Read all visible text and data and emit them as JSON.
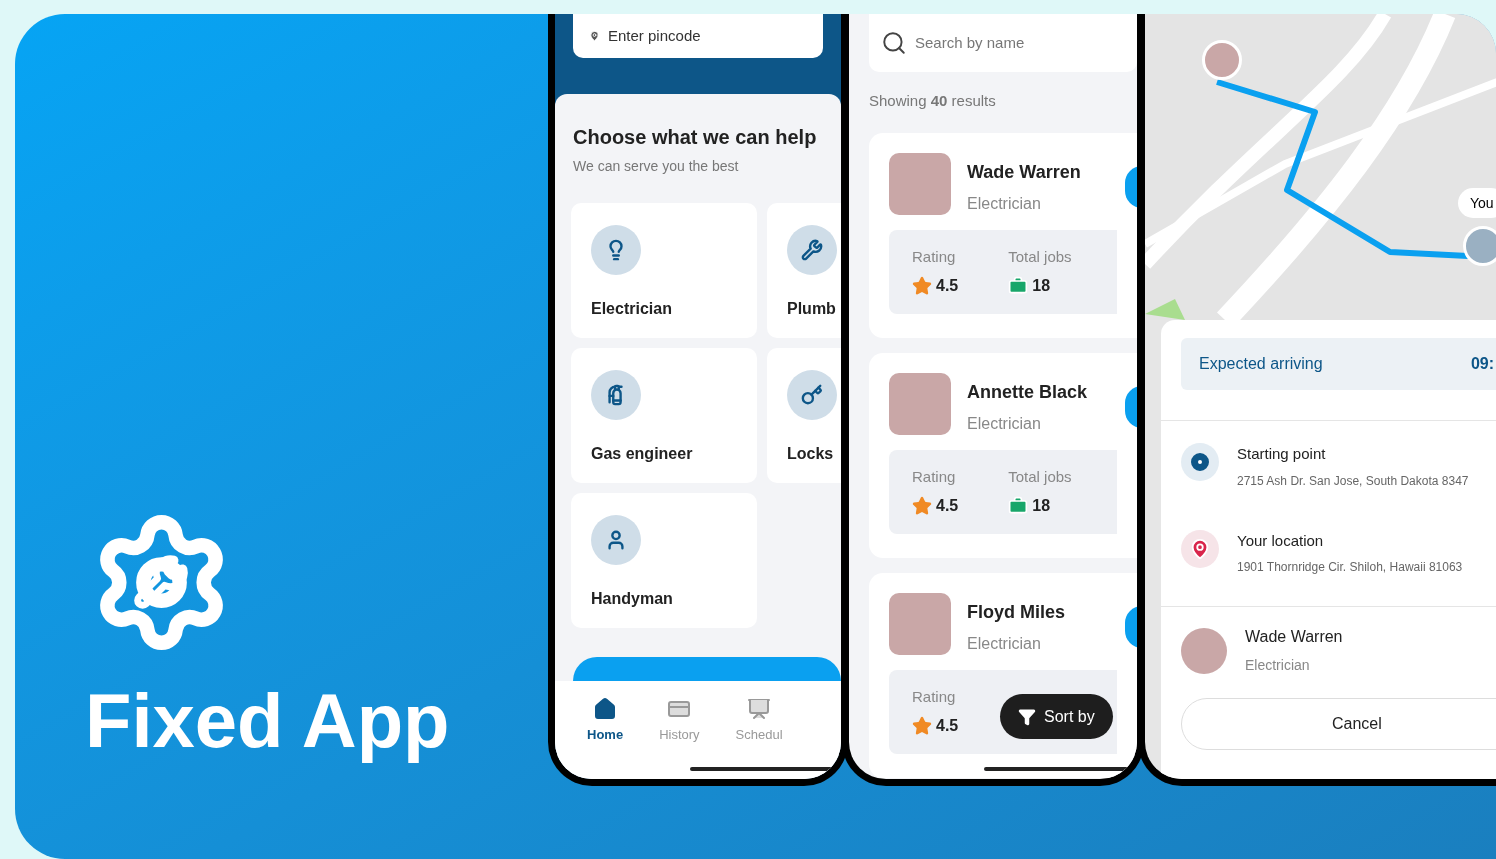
{
  "brand": {
    "title": "Fixed App"
  },
  "home_screen": {
    "pincode_field": {
      "placeholder": "Enter pincode"
    },
    "heading": "Choose what we can help",
    "subheading": "We can serve you the best",
    "services": [
      {
        "label": "Electrician",
        "kind": "bulb"
      },
      {
        "label": "Plumb",
        "kind": "wrench"
      },
      {
        "label": "Gas engineer",
        "kind": "extinguisher"
      },
      {
        "label": "Locks",
        "kind": "key"
      },
      {
        "label": "Handyman",
        "kind": "person"
      }
    ],
    "nav": [
      {
        "label": "Home",
        "kind": "home",
        "selected": true
      },
      {
        "label": "History",
        "kind": "card",
        "selected": false
      },
      {
        "label": "Schedul",
        "kind": "board",
        "selected": false
      }
    ]
  },
  "results_screen": {
    "search_field": {
      "placeholder": "Search by name"
    },
    "results_count": "Showing **40** results",
    "workers": [
      {
        "name": "Wade Warren",
        "role": "Electrician",
        "rating_label": "Rating",
        "rating": "4.5",
        "jobs_label": "Total jobs",
        "jobs": "18"
      },
      {
        "name": "Annette Black",
        "role": "Electrician",
        "rating_label": "Rating",
        "rating": "4.5",
        "jobs_label": "Total jobs",
        "jobs": "18"
      },
      {
        "name": "Floyd Miles",
        "role": "Electrician",
        "rating_label": "Rating",
        "rating": "4.5"
      }
    ],
    "sort_button": "Sort by"
  },
  "tracking_screen": {
    "you_label": "You",
    "eta": {
      "label": "Expected arriving",
      "time": "09:"
    },
    "stops": [
      {
        "kind": "start",
        "title": "Starting point",
        "address": "2715 Ash Dr. San Jose, South Dakota 8347"
      },
      {
        "kind": "destination",
        "title": "Your location",
        "address": "1901 Thornridge Cir. Shiloh, Hawaii 81063"
      }
    ],
    "worker": {
      "name": "Wade Warren",
      "role": "Electrician"
    },
    "cancel_button": "Cancel"
  }
}
